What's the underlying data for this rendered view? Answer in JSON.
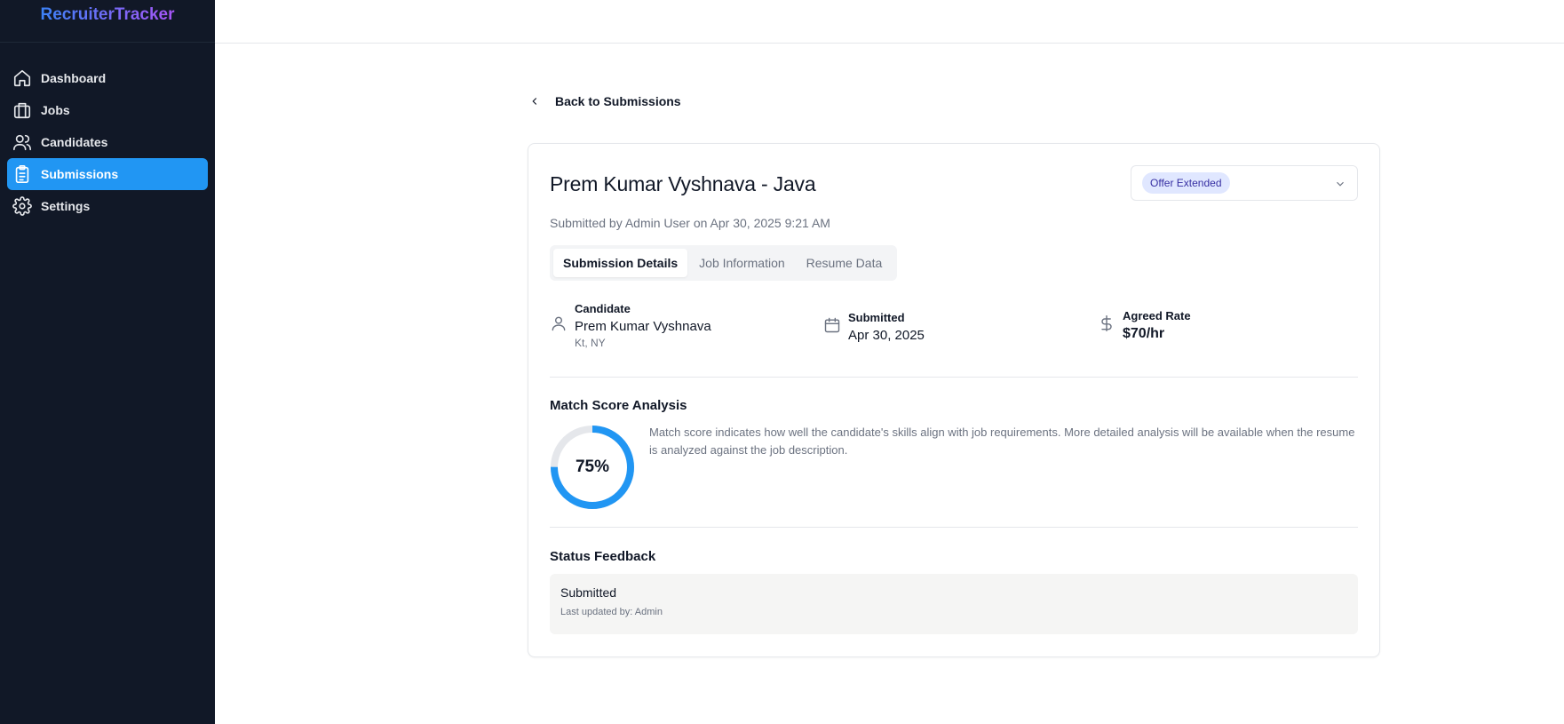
{
  "app": {
    "brand": "RecruiterTracker"
  },
  "sidebar": {
    "items": [
      {
        "label": "Dashboard",
        "icon": "home-icon",
        "active": false
      },
      {
        "label": "Jobs",
        "icon": "briefcase-icon",
        "active": false
      },
      {
        "label": "Candidates",
        "icon": "users-icon",
        "active": false
      },
      {
        "label": "Submissions",
        "icon": "clipboard-list-icon",
        "active": true
      },
      {
        "label": "Settings",
        "icon": "gear-icon",
        "active": false
      }
    ]
  },
  "back_link": {
    "label": "Back to Submissions",
    "icon": "chevron-left-icon"
  },
  "submission": {
    "title": "Prem Kumar Vyshnava - Java",
    "subtitle": "Submitted by Admin User on Apr 30, 2025 9:21 AM",
    "status": {
      "value": "Offer Extended",
      "icon": "chevron-down-icon"
    }
  },
  "tabs": [
    {
      "label": "Submission Details",
      "active": true
    },
    {
      "label": "Job Information",
      "active": false
    },
    {
      "label": "Resume Data",
      "active": false
    }
  ],
  "details": {
    "candidate": {
      "label": "Candidate",
      "name": "Prem Kumar Vyshnava",
      "location": "Kt, NY",
      "icon": "user-icon"
    },
    "submitted": {
      "label": "Submitted",
      "date": "Apr 30, 2025",
      "icon": "calendar-icon"
    },
    "rate": {
      "label": "Agreed Rate",
      "value": "$70/hr",
      "icon": "dollar-icon"
    }
  },
  "match": {
    "title": "Match Score Analysis",
    "score": 0.75,
    "score_label": "75%",
    "description": "Match score indicates how well the candidate's skills align with job requirements. More detailed analysis will be available when the resume is analyzed against the job description."
  },
  "feedback": {
    "title": "Status Feedback",
    "status": "Submitted",
    "meta": "Last updated by: Admin"
  },
  "colors": {
    "accent": "#2196f3",
    "sidebar_bg": "#111827",
    "badge_bg": "#e0e7ff",
    "badge_text": "#3730a3"
  }
}
